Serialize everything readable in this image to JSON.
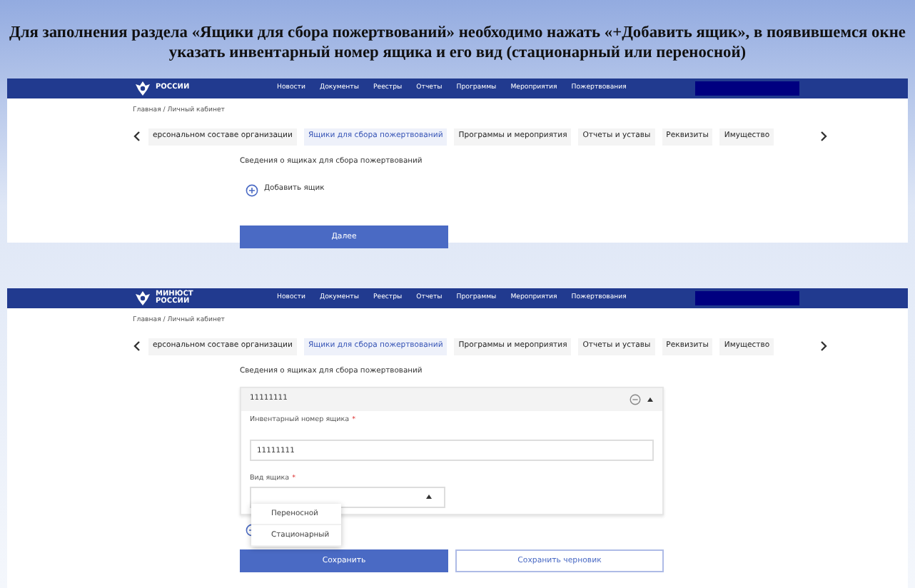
{
  "instruction": {
    "lines": [
      "Для заполнения раздела «Ящики для сбора пожертвований»  необходимо нажать «+Добавить ящик», в появившемся окне",
      "указать инвентарный номер ящика и  его вид (стационарный или переносной)"
    ]
  },
  "screens": [
    {
      "kind": "list",
      "logo_lines": [
        "РОССИИ"
      ],
      "nav": [
        "Новости",
        "Документы",
        "Реестры",
        "Отчеты",
        "Программы",
        "Мероприятия",
        "Пожертвования"
      ],
      "breadcrumb": "Главная / Личный кабинет",
      "tabs": [
        {
          "label": "ерсональном составе организации",
          "selected": false
        },
        {
          "label": "Ящики для сбора пожертвований",
          "selected": true
        },
        {
          "label": "Программы и мероприятия",
          "selected": false
        },
        {
          "label": "Отчеты и уставы",
          "selected": false
        },
        {
          "label": "Реквизиты",
          "selected": false
        },
        {
          "label": "Имущество",
          "selected": false
        }
      ],
      "section_title": "Сведения о ящиках для сбора пожертвований",
      "add_label": "Добавить ящик",
      "buttons": [
        {
          "label": "Далее",
          "kind": "primary"
        }
      ]
    },
    {
      "kind": "form",
      "logo_lines": [
        "МИНЮСТ",
        "РОССИИ"
      ],
      "nav": [
        "Новости",
        "Документы",
        "Реестры",
        "Отчеты",
        "Программы",
        "Мероприятия",
        "Пожертвования"
      ],
      "breadcrumb": "Главная / Личный кабинет",
      "tabs": [
        {
          "label": "ерсональном составе организации",
          "selected": false
        },
        {
          "label": "Ящики для сбора пожертвований",
          "selected": true
        },
        {
          "label": "Программы и мероприятия",
          "selected": false
        },
        {
          "label": "Отчеты и уставы",
          "selected": false
        },
        {
          "label": "Реквизиты",
          "selected": false
        },
        {
          "label": "Имущество",
          "selected": false
        }
      ],
      "section_title": "Сведения о ящиках для сбора пожертвований",
      "box": {
        "header": "11111111",
        "expanded": true,
        "fields": [
          {
            "label": "Инвентарный номер ящика",
            "required_mark": "*",
            "kind": "input",
            "value": "11111111"
          },
          {
            "label": "Вид ящика",
            "required_mark": "*",
            "kind": "select",
            "open": true,
            "options": [
              "Переносной",
              "Стационарный"
            ]
          }
        ]
      },
      "buttons": [
        {
          "label": "Сохранить",
          "kind": "primary"
        },
        {
          "label": "Сохранить черновик",
          "kind": "outline"
        }
      ]
    }
  ]
}
